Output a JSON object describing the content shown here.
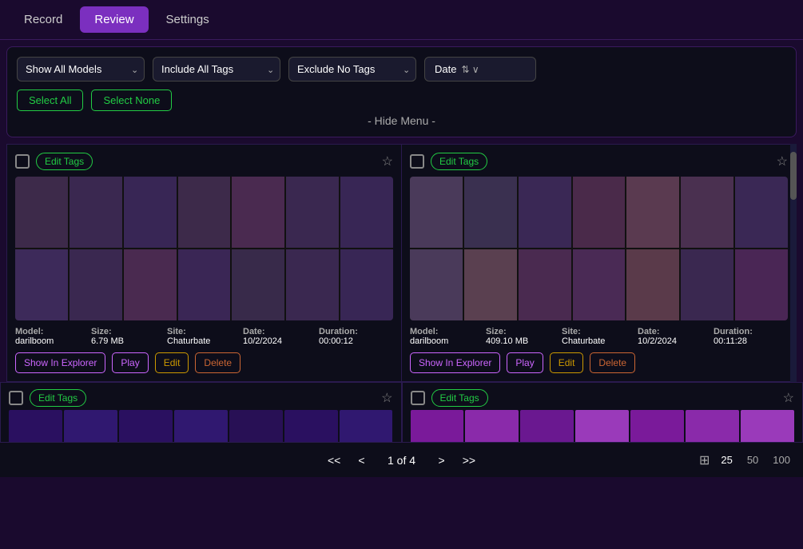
{
  "header": {
    "tabs": [
      {
        "label": "Record",
        "active": false
      },
      {
        "label": "Review",
        "active": true
      },
      {
        "label": "Settings",
        "active": false
      }
    ]
  },
  "controls": {
    "model_dropdown": "Show All Models",
    "tags_include_dropdown": "Include All Tags",
    "tags_exclude_dropdown": "Exclude No Tags",
    "sort_dropdown": "Date",
    "select_all_label": "Select All",
    "select_none_label": "Select None",
    "hide_menu_label": "- Hide Menu -"
  },
  "cards": [
    {
      "id": 1,
      "edit_tags_label": "Edit Tags",
      "model_label": "Model:",
      "model_value": "darilboom",
      "size_label": "Size:",
      "size_value": "6.79 MB",
      "site_label": "Site:",
      "site_value": "Chaturbate",
      "date_label": "Date:",
      "date_value": "10/2/2024",
      "duration_label": "Duration:",
      "duration_value": "00:00:12",
      "show_explorer_label": "Show In Explorer",
      "play_label": "Play",
      "edit_label": "Edit",
      "delete_label": "Delete"
    },
    {
      "id": 2,
      "edit_tags_label": "Edit Tags",
      "model_label": "Model:",
      "model_value": "darilboom",
      "size_label": "Size:",
      "size_value": "409.10 MB",
      "site_label": "Site:",
      "site_value": "Chaturbate",
      "date_label": "Date:",
      "date_value": "10/2/2024",
      "duration_label": "Duration:",
      "duration_value": "00:11:28",
      "show_explorer_label": "Show In Explorer",
      "play_label": "Play",
      "edit_label": "Edit",
      "delete_label": "Delete"
    },
    {
      "id": 3,
      "edit_tags_label": "Edit Tags"
    },
    {
      "id": 4,
      "edit_tags_label": "Edit Tags"
    }
  ],
  "pagination": {
    "first_label": "<<",
    "prev_label": "<",
    "page_info": "1 of 4",
    "next_label": ">",
    "last_label": ">>",
    "per_page_options": [
      "25",
      "50",
      "100"
    ]
  }
}
